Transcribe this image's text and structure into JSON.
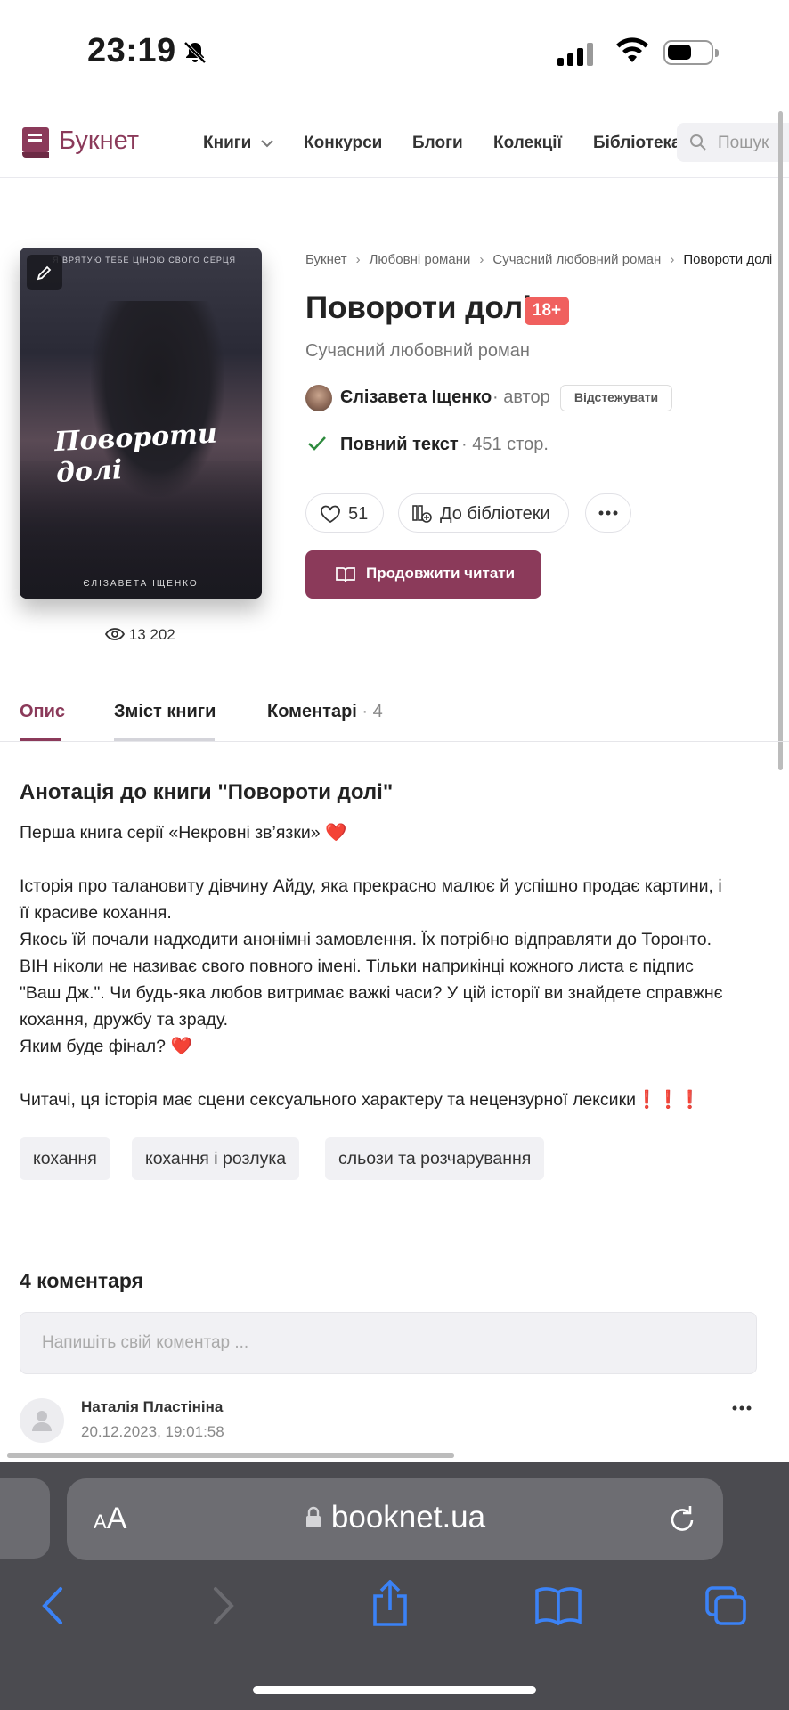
{
  "status_bar": {
    "time": "23:19"
  },
  "header": {
    "logo_text": "Букнет",
    "nav": [
      "Книги",
      "Конкурси",
      "Блоги",
      "Колекції",
      "Бібліотека"
    ],
    "search_placeholder": "Пошук"
  },
  "book": {
    "cover_top_text": "Я ВРЯТУЮ ТЕБЕ ЦІНОЮ СВОГО СЕРЦЯ",
    "cover_title": "Повороти долі",
    "cover_author": "ЄЛІЗАВЕТА ІЩЕНКО",
    "views": "13 202",
    "breadcrumb": [
      "Букнет",
      "Любовні романи",
      "Сучасний любовний роман",
      "Повороти долі"
    ],
    "title": "Повороти долі",
    "age_badge": "18+",
    "genre": "Сучасний любовний роман",
    "author_name": "Єлізавета Іщенко",
    "author_role": "· автор",
    "follow_label": "Відстежувати",
    "status": "Повний текст",
    "pages": "· 451 стор.",
    "likes": "51",
    "library_label": "До бібліотеки",
    "read_label": "Продовжити читати"
  },
  "tabs": [
    {
      "label": "Опис"
    },
    {
      "label": "Зміст книги"
    },
    {
      "label": "Коментарі",
      "count": "· 4"
    }
  ],
  "annotation": {
    "title": "Анотація до книги \"Повороти долі\"",
    "lines": [
      "Перша книга серії «Некровні зв’язки» ❤️",
      "",
      "Історія про талановиту дівчину Айду, яка прекрасно малює й успішно продає картини, і",
      "її красиве кохання.",
      "Якось їй почали надходити анонімні замовлення. Їх потрібно відправляти до Торонто.",
      "ВІН ніколи не називає свого повного імені. Тільки наприкінці кожного листа є підпис",
      "\"Ваш Дж.\". Чи будь-яка любов витримає важкі часи? У цій історії ви знайдете справжнє",
      "кохання, дружбу та зраду.",
      "Яким буде фінал? ❤️",
      "",
      "Читачі, ця історія має сцени сексуального характеру та нецензурної лексики❗❗❗"
    ],
    "tags": [
      "кохання",
      "кохання і розлука",
      "сльози та розчарування"
    ]
  },
  "comments": {
    "title": "4 коментаря",
    "input_placeholder": "Напишіть свій коментар ...",
    "items": [
      {
        "name": "Наталія Пластініна",
        "date": "20.12.2023, 19:01:58"
      }
    ]
  },
  "safari": {
    "aa_small": "A",
    "aa_large": "A",
    "url": "booknet.ua"
  },
  "colors": {
    "brand": "#8b3a5a",
    "age_badge": "#f0605e",
    "check": "#2e8b3e",
    "ios_blue": "#3b82f6"
  }
}
